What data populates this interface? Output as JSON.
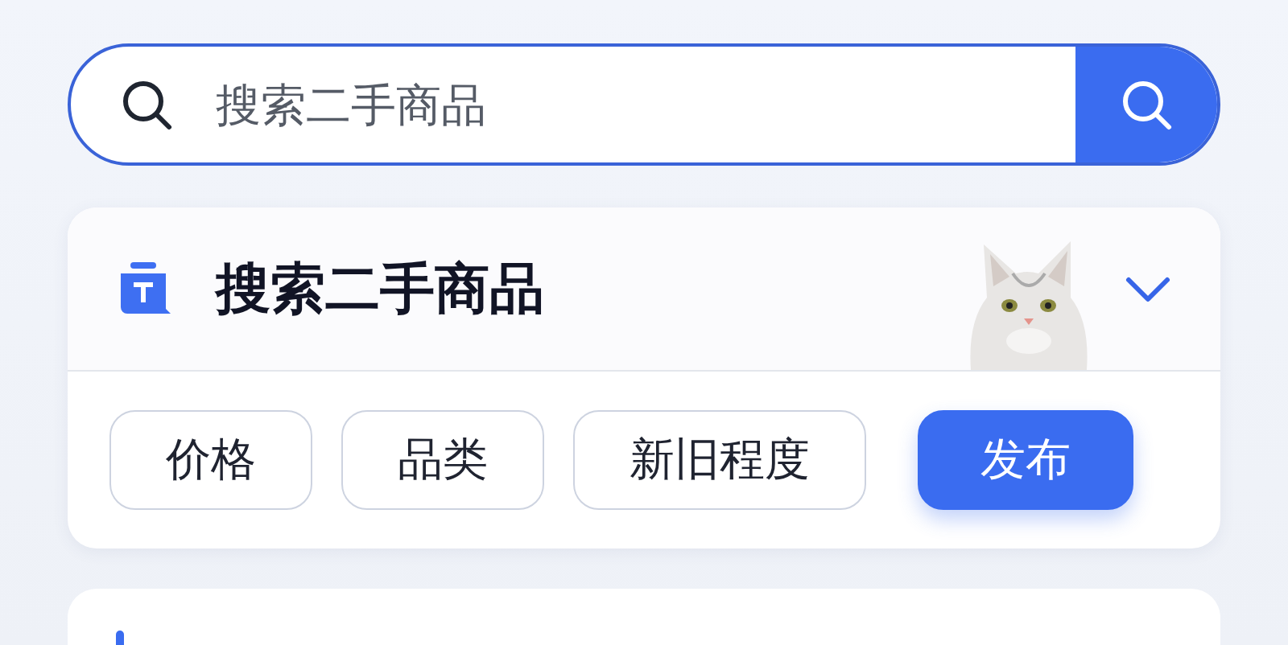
{
  "search_bar": {
    "placeholder": "搜索二手商品"
  },
  "search_card": {
    "title": "搜索二手商品",
    "expanded": false,
    "filters": [
      {
        "label": "价格",
        "kind": "filter"
      },
      {
        "label": "品类",
        "kind": "filter"
      },
      {
        "label": "新旧程度",
        "kind": "filter"
      },
      {
        "label": "发布",
        "kind": "primary"
      }
    ]
  }
}
